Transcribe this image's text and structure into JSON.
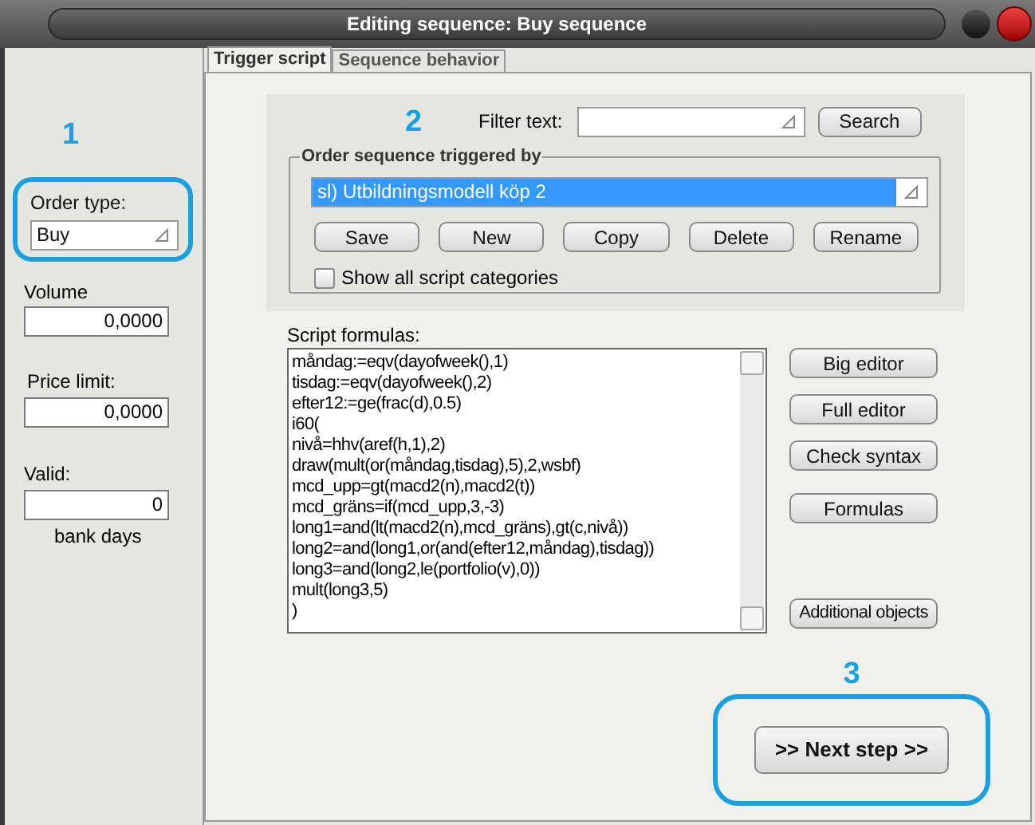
{
  "window": {
    "title": "Editing sequence: Buy sequence"
  },
  "annotations": [
    "1",
    "2",
    "3"
  ],
  "left_panel": {
    "order_type": {
      "label": "Order type:",
      "value": "Buy"
    },
    "volume": {
      "label": "Volume",
      "value": "0,0000"
    },
    "price_limit": {
      "label": "Price limit:",
      "value": "0,0000"
    },
    "valid": {
      "label": "Valid:",
      "value": "0",
      "unit": "bank days"
    }
  },
  "tabs": [
    {
      "label": "Trigger script",
      "selected": true
    },
    {
      "label": "Sequence behavior",
      "selected": false
    }
  ],
  "filter": {
    "label": "Filter text:",
    "button": "Search"
  },
  "sequence_group": {
    "title": "Order sequence triggered by",
    "selected_value": "sl) Utbildningsmodell köp 2",
    "buttons": [
      "Save",
      "New",
      "Copy",
      "Delete",
      "Rename"
    ],
    "show_all": {
      "label": "Show all script categories",
      "checked": false
    }
  },
  "script": {
    "label": "Script formulas:",
    "lines": [
      "måndag:=eqv(dayofweek(),1)",
      "tisdag:=eqv(dayofweek(),2)",
      "efter12:=ge(frac(d),0.5)",
      "i60(",
      "nivå=hhv(aref(h,1),2)",
      "draw(mult(or(måndag,tisdag),5),2,wsbf)",
      "mcd_upp=gt(macd2(n),macd2(t))",
      "mcd_gräns=if(mcd_upp,3,-3)",
      "long1=and(lt(macd2(n),mcd_gräns),gt(c,nivå))",
      "long2=and(long1,or(and(efter12,måndag),tisdag))",
      "long3=and(long2,le(portfolio(v),0))",
      "mult(long3,5)",
      ")"
    ]
  },
  "editor_buttons": [
    {
      "label": "Big editor",
      "kind": "top"
    },
    {
      "label": "Full editor",
      "kind": "top"
    },
    {
      "label": "Check syntax",
      "kind": "top"
    },
    {
      "label": "Formulas",
      "kind": "top"
    },
    {
      "label": "Additional objects",
      "kind": "bottom"
    }
  ],
  "next_button": ">> Next step >>"
}
